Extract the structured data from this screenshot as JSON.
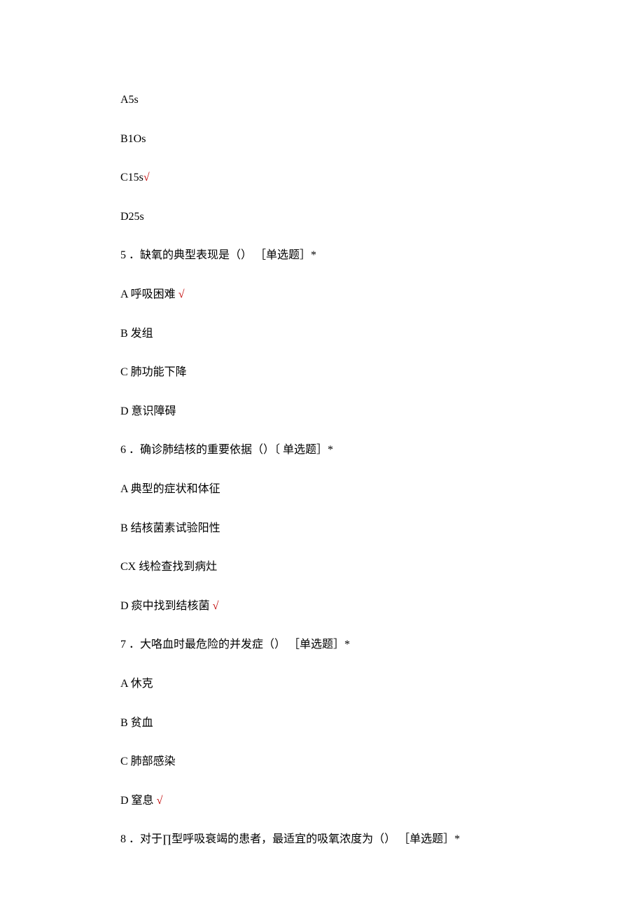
{
  "lines": [
    {
      "text": "A5s",
      "checked": false
    },
    {
      "text": "B1Os",
      "checked": false
    },
    {
      "text": "C15s",
      "checked": true
    },
    {
      "text": "D25s",
      "checked": false
    }
  ],
  "q5": {
    "prompt": "5 ．缺氧的典型表现是（） ［单选题］*",
    "options": [
      {
        "text": "A 呼吸困难 ",
        "checked": true
      },
      {
        "text": "B 发组",
        "checked": false
      },
      {
        "text": "C 肺功能下降",
        "checked": false
      },
      {
        "text": "D 意识障碍",
        "checked": false
      }
    ]
  },
  "q6": {
    "prompt": "6 ．确诊肺结核的重要依据（）〔 单选题］*",
    "options": [
      {
        "text": "A 典型的症状和体征",
        "checked": false
      },
      {
        "text": "B 结核菌素试验阳性",
        "checked": false
      },
      {
        "text": "CX 线检查找到病灶",
        "checked": false
      },
      {
        "text": "D 痰中找到结核菌 ",
        "checked": true
      }
    ]
  },
  "q7": {
    "prompt": "7 ．大咯血时最危险的并发症（） ［单选题］*",
    "options": [
      {
        "text": "A 休克",
        "checked": false
      },
      {
        "text": "B 贫血",
        "checked": false
      },
      {
        "text": "C 肺部感染",
        "checked": false
      },
      {
        "text": "D 窒息 ",
        "checked": true
      }
    ]
  },
  "q8": {
    "prompt": "8 ．对于∏型呼吸衰竭的患者，最适宜的吸氧浓度为（） ［单选题］*"
  },
  "checkmark": "√"
}
